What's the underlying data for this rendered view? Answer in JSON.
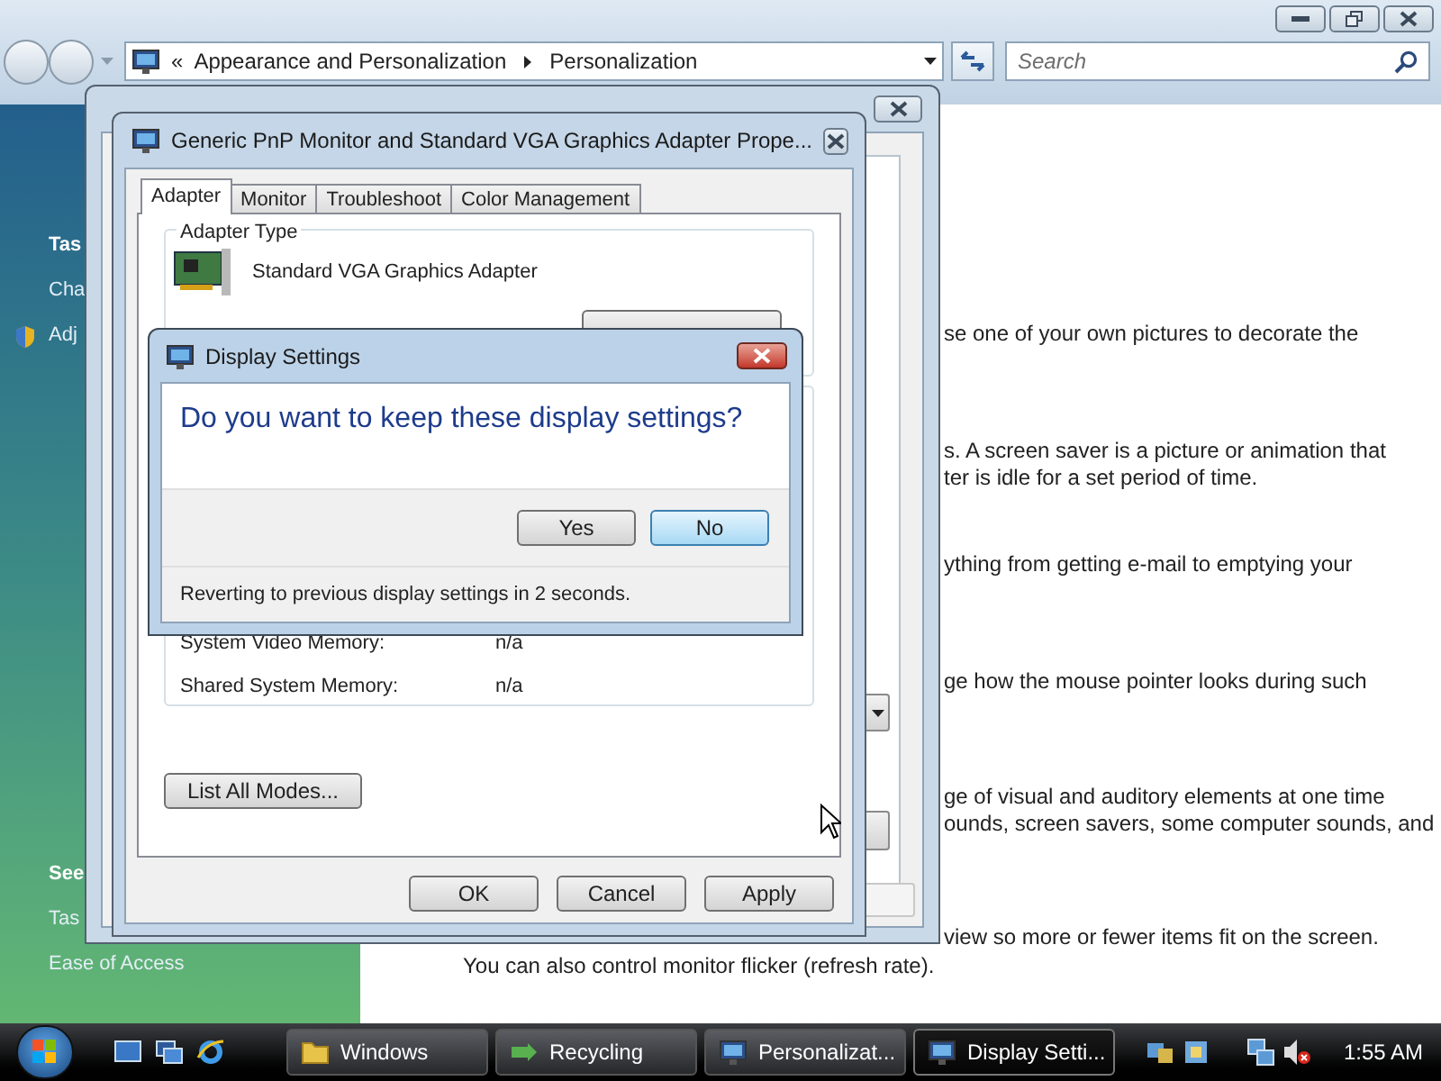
{
  "explorer": {
    "breadcrumb": {
      "prefix": "«",
      "items": [
        "Appearance and Personalization",
        "Personalization"
      ]
    },
    "search": {
      "placeholder": "Search"
    },
    "sidebar": {
      "top_items": [
        {
          "text": "Tas",
          "kind": "heading"
        },
        {
          "text": "Cha",
          "kind": "link"
        },
        {
          "text": "Adj",
          "kind": "shield-link"
        }
      ],
      "bottom_items": [
        {
          "text": "See",
          "kind": "heading"
        },
        {
          "text": "Tas",
          "kind": "link"
        },
        {
          "text": "Ease of Access",
          "kind": "link"
        }
      ]
    },
    "content": {
      "clipped_paragraphs": [
        [
          "se one of your own pictures to decorate the"
        ],
        [
          "s. A screen saver is a picture or animation that",
          "ter is idle for a set period of time."
        ],
        [
          "ything from getting e-mail to emptying your"
        ],
        [
          "ge how the mouse pointer looks during such"
        ],
        [
          "ge of visual and auditory elements at one time",
          "ounds, screen savers, some computer sounds, and"
        ],
        [
          "view so more or fewer items fit on the screen."
        ]
      ],
      "last_line": "You can also control monitor flicker (refresh rate)."
    }
  },
  "properties_window": {
    "title": "Generic PnP Monitor and Standard VGA Graphics Adapter Prope...",
    "tabs": [
      {
        "label": "Adapter",
        "selected": true
      },
      {
        "label": "Monitor",
        "selected": false
      },
      {
        "label": "Troubleshoot",
        "selected": false
      },
      {
        "label": "Color Management",
        "selected": false
      }
    ],
    "adapter_type": {
      "label": "Adapter Type",
      "name": "Standard VGA Graphics Adapter"
    },
    "memory_rows": [
      {
        "label": "System Video Memory:",
        "value": "n/a"
      },
      {
        "label": "Shared System Memory:",
        "value": "n/a"
      }
    ],
    "list_modes_button": "List All Modes...",
    "buttons": [
      "OK",
      "Cancel",
      "Apply"
    ]
  },
  "confirm_dialog": {
    "title": "Display Settings",
    "question": "Do you want to keep these display settings?",
    "buttons": [
      {
        "label": "Yes",
        "default": false
      },
      {
        "label": "No",
        "default": true
      }
    ],
    "footer": "Reverting to previous display settings in 2 seconds."
  },
  "taskbar": {
    "tasks": [
      {
        "label": "Windows",
        "kind": "folder",
        "selected": false
      },
      {
        "label": "Recycling",
        "kind": "recycle",
        "selected": false
      },
      {
        "label": "Personalizat...",
        "kind": "personalize",
        "selected": false
      },
      {
        "label": "Display Setti...",
        "kind": "display",
        "selected": true
      }
    ],
    "clock": "1:55 AM"
  }
}
